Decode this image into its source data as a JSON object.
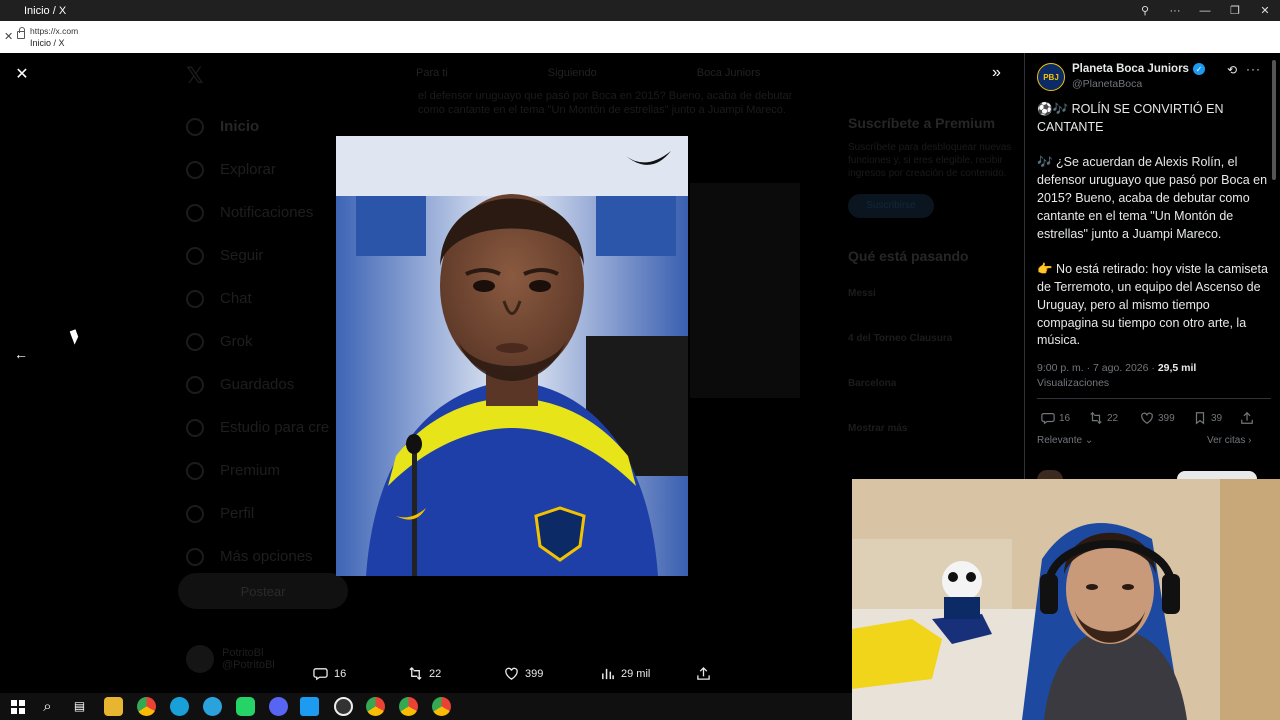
{
  "window": {
    "title": "Inicio / X"
  },
  "urlbar": {
    "url": "https://x.com",
    "page_title": "Inicio / X"
  },
  "bg_nav": {
    "items": [
      "Inicio",
      "Explorar",
      "Notificaciones",
      "Seguir",
      "Chat",
      "Grok",
      "Guardados",
      "Estudio para cre",
      "Premium",
      "Perfil",
      "Más opciones"
    ],
    "post_button": "Postear",
    "user_name": "PotritoBl",
    "user_handle": "@PotritoBl"
  },
  "bg_feed": {
    "tabs": [
      "Para ti",
      "Siguiendo",
      "Boca Juniors"
    ],
    "text": "el defensor uruguayo que pasó por Boca en 2015? Bueno, acaba de debutar como cantante en el tema \"Un Montón de estrellas\" junto a Juampi Mareco."
  },
  "bg_right": {
    "premium_title": "Suscríbete a Premium",
    "premium_text": "Suscríbete para desbloquear nuevas funciones y, si eres elegible, recibir ingresos por creación de contenido.",
    "premium_button": "Suscribirse",
    "trending_title": "Qué está pasando",
    "trends": [
      "Messi",
      "4 del Torneo Clausura",
      "Barcelona",
      "Mostrar más"
    ]
  },
  "media_actions": {
    "replies": "16",
    "reposts": "22",
    "likes": "399",
    "views": "29 mil"
  },
  "tweet": {
    "author_name": "Planeta Boca Juniors",
    "author_handle": "@PlanetaBoca",
    "avatar_text": "PBJ",
    "text": "⚽🎶 ROLÍN SE CONVIRTIÓ EN CANTANTE\n\n🎶 ¿Se acuerdan de Alexis Rolín, el defensor uruguayo que pasó por Boca en 2015? Bueno, acaba de debutar como cantante en el tema \"Un Montón de estrellas\" junto a Juampi Mareco.\n\n👉 No está retirado: hoy viste la camiseta de Terremoto, un equipo del Ascenso de Uruguay, pero al mismo tiempo compagina su tiempo con otro arte, la música.",
    "timestamp": "9:00 p. m. · 7 ago. 2026 · ",
    "views_count": "29,5 mil",
    "views_label": "Visualizaciones",
    "replies": "16",
    "reposts": "22",
    "likes": "399",
    "bookmarks": "39",
    "sort_label": "Relevante",
    "quotes_label": "Ver citas"
  },
  "colors": {
    "x_blue": "#1d9bf0",
    "boca_blue": "#0b2a66",
    "boca_yellow": "#f2c200",
    "muted_text": "#71767b"
  }
}
